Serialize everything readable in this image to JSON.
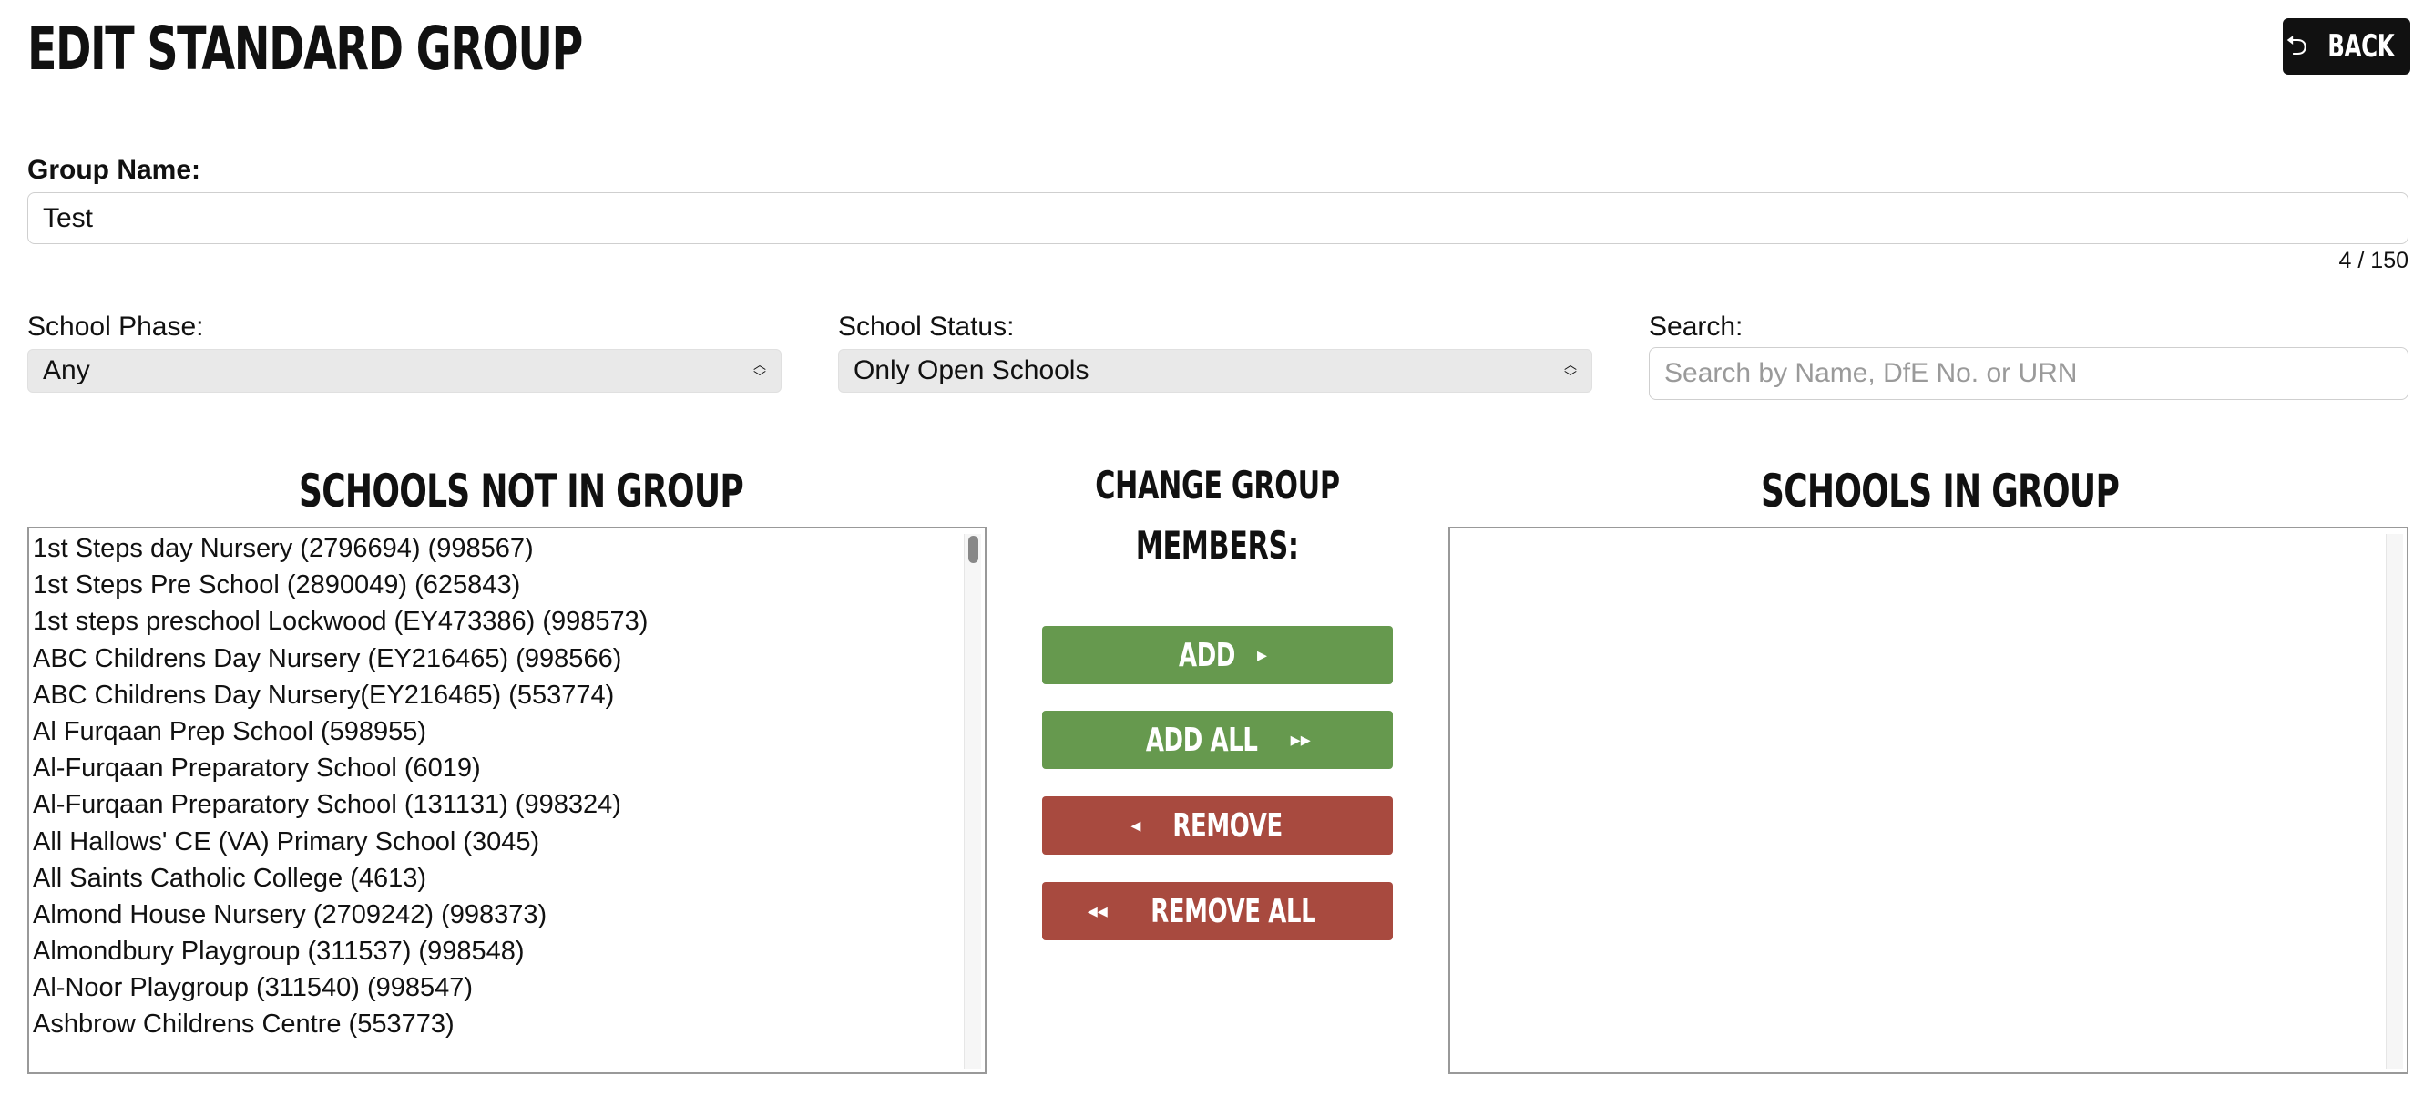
{
  "page": {
    "title": "EDIT STANDARD GROUP",
    "back_label": "BACK"
  },
  "group_name": {
    "label": "Group Name:",
    "value": "Test",
    "counter": "4 / 150"
  },
  "filters": {
    "phase": {
      "label": "School Phase:",
      "selected": "Any"
    },
    "status": {
      "label": "School Status:",
      "selected": "Only Open Schools"
    },
    "search": {
      "label": "Search:",
      "placeholder": "Search by Name, DfE No. or URN",
      "value": ""
    }
  },
  "not_in_group": {
    "title": "SCHOOLS NOT IN GROUP",
    "items": [
      "1st Steps day Nursery (2796694) (998567)",
      "1st Steps Pre School (2890049) (625843)",
      "1st steps preschool Lockwood (EY473386) (998573)",
      "ABC Childrens Day Nursery (EY216465) (998566)",
      "ABC Childrens Day Nursery(EY216465) (553774)",
      "Al Furqaan Prep School (598955)",
      "Al-Furqaan Preparatory School (6019)",
      "Al-Furqaan Preparatory School (131131) (998324)",
      "All Hallows' CE (VA) Primary School (3045)",
      "All Saints Catholic College (4613)",
      "Almond House Nursery (2709242) (998373)",
      "Almondbury Playgroup (311537) (998548)",
      "Al-Noor Playgroup (311540) (998547)",
      "Ashbrow Childrens Centre (553773)"
    ]
  },
  "change_members": {
    "title_line1": "CHANGE GROUP",
    "title_line2": "MEMBERS:",
    "add_label": "ADD",
    "add_all_label": "ADD ALL",
    "remove_label": "REMOVE",
    "remove_all_label": "REMOVE ALL"
  },
  "in_group": {
    "title": "SCHOOLS IN GROUP",
    "items": []
  },
  "icons": {
    "back": "return-arrow-icon",
    "add": "play-right-icon",
    "add_all": "fast-forward-icon",
    "remove": "play-left-icon",
    "remove_all": "rewind-icon",
    "select": "up-down-chevron-icon"
  },
  "colors": {
    "add_button": "#66994e",
    "remove_button": "#a84a3f",
    "back_button": "#111111"
  }
}
